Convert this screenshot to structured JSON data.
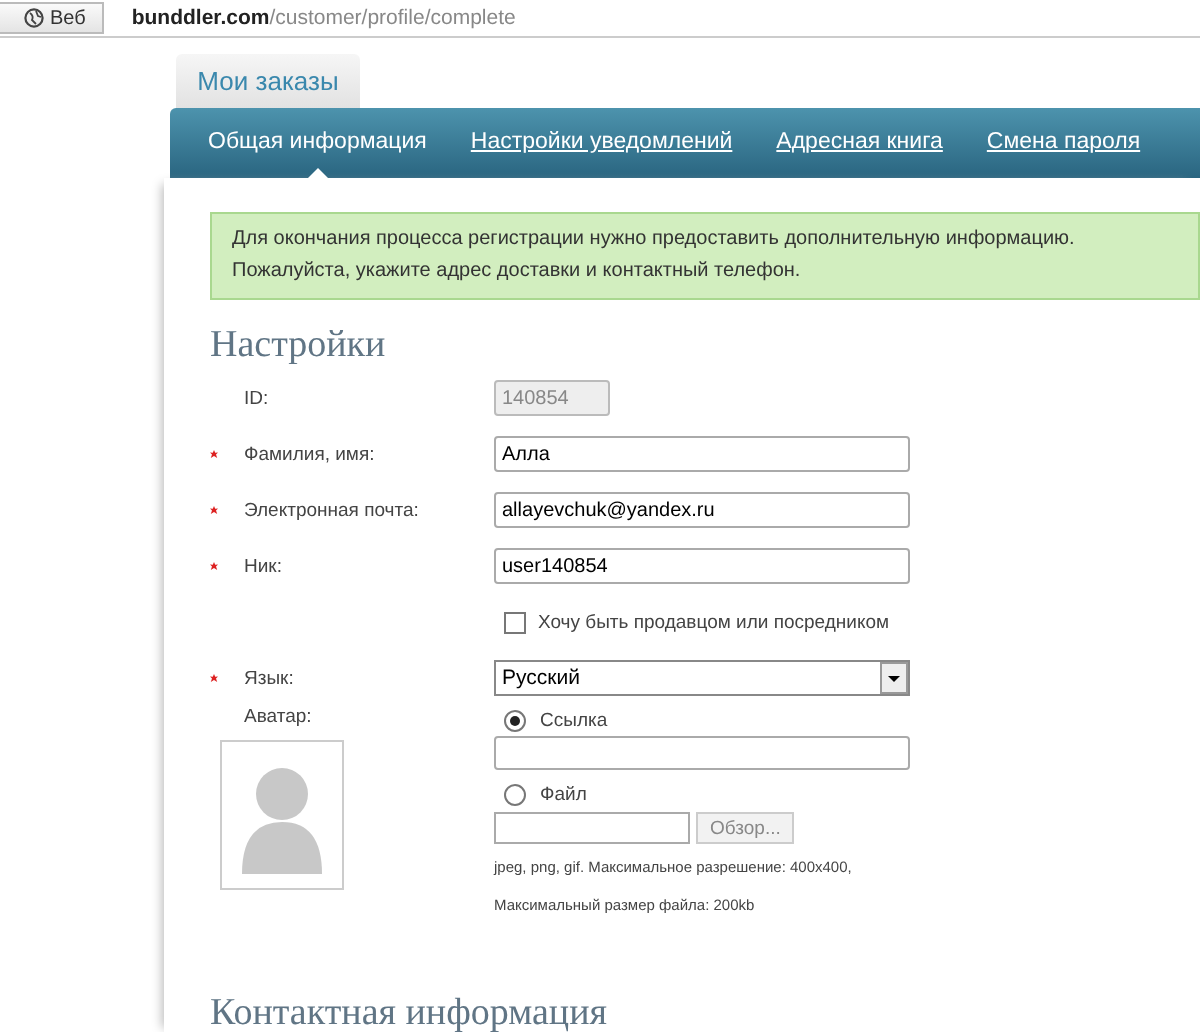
{
  "browser": {
    "badge": "Веб",
    "url": "**bunddler.com**/customer/profile/complete"
  },
  "top_tabs": [
    {
      "label": "Мои заказы"
    }
  ],
  "nav": [
    {
      "label": "Общая информация",
      "selected": true
    },
    {
      "label": "Настройки уведомлений",
      "selected": false
    },
    {
      "label": "Адресная книга",
      "selected": false
    },
    {
      "label": "Смена пароля",
      "selected": false
    }
  ],
  "alert": {
    "lines": [
      "Для окончания процесса регистрации нужно предоставить дополнительную информацию.",
      "Пожалуйста, укажите адрес доставки и контактный телефон."
    ]
  },
  "section_title": "Настройки",
  "fields": [
    {
      "kind": "text",
      "label": "ID:",
      "required": false,
      "disabled": true,
      "value": "140854"
    },
    {
      "kind": "text",
      "label": "Фамилия, имя:",
      "required": true,
      "disabled": false,
      "value": "Алла"
    },
    {
      "kind": "text",
      "label": "Электронная почта:",
      "required": true,
      "disabled": false,
      "value": "allayevchuk@yandex.ru"
    },
    {
      "kind": "text",
      "label": "Ник:",
      "required": true,
      "disabled": false,
      "value": "user140854"
    },
    {
      "kind": "checkbox",
      "label": "Хочу быть продавцом или посредником",
      "checked": false
    },
    {
      "kind": "select",
      "label": "Язык:",
      "required": true,
      "value": "Русский"
    }
  ],
  "avatar": {
    "label": "Аватар:",
    "options": [
      {
        "label": "Ссылка",
        "selected": true
      },
      {
        "label": "Файл",
        "selected": false
      }
    ],
    "browse_button": "Обзор...",
    "hints": [
      "jpeg, png, gif. Максимальное разрешение: 400x400,",
      "Максимальный размер файла: 200kb"
    ]
  },
  "next_section_title": "Контактная информация"
}
